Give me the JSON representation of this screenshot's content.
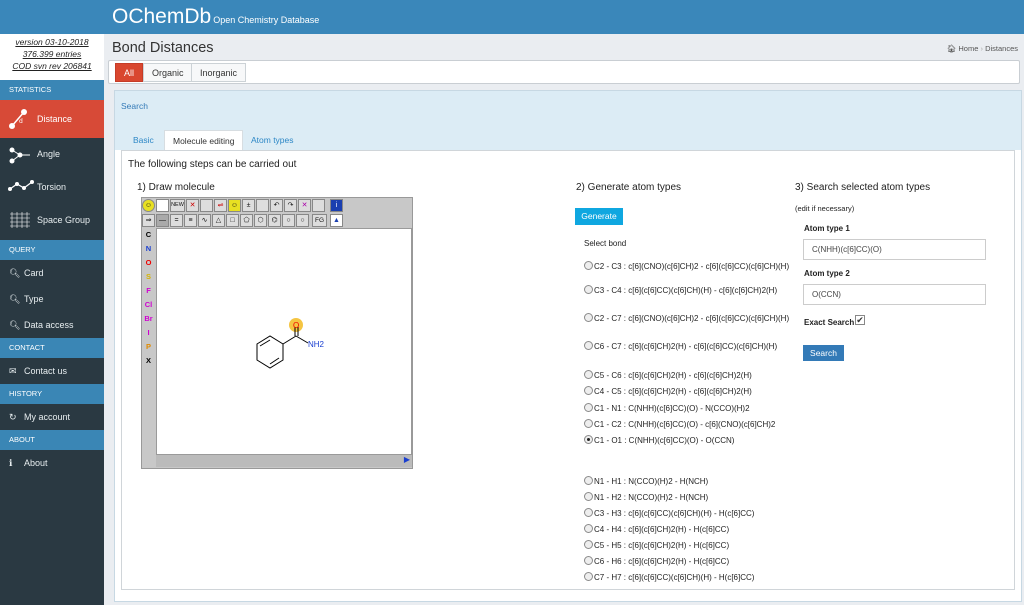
{
  "app": {
    "brand": "OChemDb",
    "subtitle": "Open Chemistry Database"
  },
  "version": {
    "line1": "version 03-10-2018",
    "line2": "376.399 entries",
    "line3": "COD svn rev 206841"
  },
  "sidebar": {
    "statistics_title": "STATISTICS",
    "stats": [
      "Distance",
      "Angle",
      "Torsion",
      "Space Group"
    ],
    "query_title": "QUERY",
    "query": [
      "Card",
      "Type",
      "Data access"
    ],
    "contact_title": "CONTACT",
    "contact": [
      "Contact us"
    ],
    "history_title": "HISTORY",
    "history": [
      "My account"
    ],
    "about_title": "ABOUT",
    "about": [
      "About"
    ]
  },
  "page": {
    "title": "Bond Distances",
    "breadcrumb_home": "Home",
    "breadcrumb_current": "Distances"
  },
  "filter_tabs": [
    "All",
    "Organic",
    "Inorganic"
  ],
  "search": {
    "header": "Search",
    "tabs": [
      "Basic",
      "Molecule editing",
      "Atom types"
    ]
  },
  "steps": {
    "intro": "The following steps can be carried out",
    "step1": "1) Draw molecule",
    "step2": "2) Generate atom types",
    "step3": "3) Search selected atom types",
    "edit_hint": "(edit if necessary)",
    "generate_label": "Generate",
    "select_bond": "Select bond"
  },
  "editor": {
    "toolbar_new": "NEW",
    "toolbar_fg": "FG",
    "elements": [
      "C",
      "N",
      "O",
      "S",
      "F",
      "Cl",
      "Br",
      "I",
      "P",
      "X"
    ],
    "atom_o": "O",
    "atom_nh2": "NH2"
  },
  "bonds": [
    "C2 - C3 : c[6](CNO)(c[6]CH)2 - c[6](c[6]CC)(c[6]CH)(H)",
    "C3 - C4 : c[6](c[6]CC)(c[6]CH)(H) - c[6](c[6]CH)2(H)",
    "C2 - C7 : c[6](CNO)(c[6]CH)2 - c[6](c[6]CC)(c[6]CH)(H)",
    "C6 - C7 : c[6](c[6]CH)2(H) - c[6](c[6]CC)(c[6]CH)(H)",
    "C5 - C6 : c[6](c[6]CH)2(H) - c[6](c[6]CH)2(H)",
    "C4 - C5 : c[6](c[6]CH)2(H) - c[6](c[6]CH)2(H)",
    "C1 - N1 : C(NHH)(c[6]CC)(O) - N(CCO)(H)2",
    "C1 - C2 : C(NHH)(c[6]CC)(O) - c[6](CNO)(c[6]CH)2",
    "C1 - O1 : C(NHH)(c[6]CC)(O) - O(CCN)",
    "N1 - H1 : N(CCO)(H)2 - H(NCH)",
    "N1 - H2 : N(CCO)(H)2 - H(NCH)",
    "C3 - H3 : c[6](c[6]CC)(c[6]CH)(H) - H(c[6]CC)",
    "C4 - H4 : c[6](c[6]CH)2(H) - H(c[6]CC)",
    "C5 - H5 : c[6](c[6]CH)2(H) - H(c[6]CC)",
    "C6 - H6 : c[6](c[6]CH)2(H) - H(c[6]CC)",
    "C7 - H7 : c[6](c[6]CC)(c[6]CH)(H) - H(c[6]CC)"
  ],
  "selected_bond_index": 8,
  "atom_type1": {
    "label": "Atom type 1",
    "value": "C(NHH)(c[6]CC)(O)"
  },
  "atom_type2": {
    "label": "Atom type 2",
    "value": "O(CCN)"
  },
  "exact_search": {
    "label": "Exact Search",
    "checked": true
  },
  "search_button": "Search"
}
